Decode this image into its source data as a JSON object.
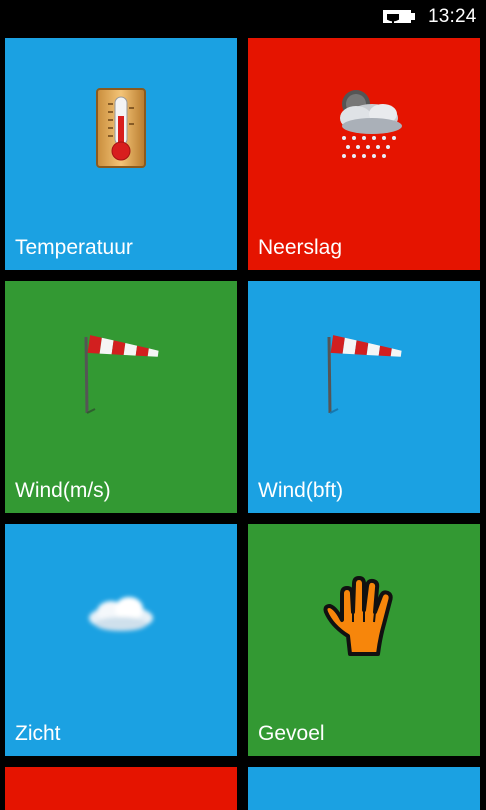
{
  "status_bar": {
    "time": "13:24",
    "battery_icon": "battery-charging-icon"
  },
  "colors": {
    "blue": "#1ba1e2",
    "red": "#e51400",
    "green": "#339933",
    "background": "#000000"
  },
  "tiles": [
    {
      "label": "Temperatuur",
      "color": "#1ba1e2",
      "icon": "thermometer-icon"
    },
    {
      "label": "Neerslag",
      "color": "#e51400",
      "icon": "rain-cloud-icon"
    },
    {
      "label": "Wind(m/s)",
      "color": "#339933",
      "icon": "windsock-icon"
    },
    {
      "label": "Wind(bft)",
      "color": "#1ba1e2",
      "icon": "windsock-icon"
    },
    {
      "label": "Zicht",
      "color": "#1ba1e2",
      "icon": "cloud-icon"
    },
    {
      "label": "Gevoel",
      "color": "#339933",
      "icon": "hand-icon"
    },
    {
      "label": "",
      "color": "#e51400",
      "icon": ""
    },
    {
      "label": "",
      "color": "#1ba1e2",
      "icon": ""
    }
  ]
}
